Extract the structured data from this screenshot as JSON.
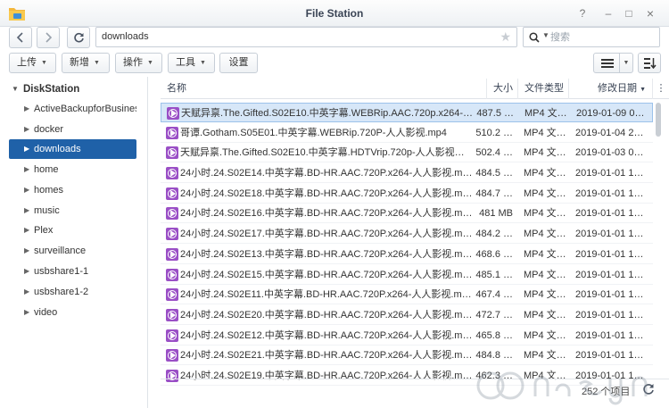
{
  "window": {
    "title": "File Station",
    "controls": [
      "?",
      "–",
      "□",
      "×"
    ]
  },
  "nav": {
    "back_icon": "chevron-left-icon",
    "forward_icon": "chevron-right-icon",
    "refresh_icon": "refresh-icon",
    "path": "downloads",
    "favorite_icon": "star-icon"
  },
  "search": {
    "placeholder": "搜索"
  },
  "toolbar": {
    "upload_label": "上传",
    "create_label": "新增",
    "action_label": "操作",
    "tools_label": "工具",
    "settings_label": "设置"
  },
  "sidebar": {
    "root": "DiskStation",
    "items": [
      {
        "label": "ActiveBackupforBusiness",
        "selected": false
      },
      {
        "label": "docker",
        "selected": false
      },
      {
        "label": "downloads",
        "selected": true
      },
      {
        "label": "home",
        "selected": false
      },
      {
        "label": "homes",
        "selected": false
      },
      {
        "label": "music",
        "selected": false
      },
      {
        "label": "Plex",
        "selected": false
      },
      {
        "label": "surveillance",
        "selected": false
      },
      {
        "label": "usbshare1-1",
        "selected": false
      },
      {
        "label": "usbshare1-2",
        "selected": false
      },
      {
        "label": "video",
        "selected": false
      }
    ]
  },
  "columns": {
    "name": "名称",
    "size": "大小",
    "type": "文件类型",
    "date": "修改日期"
  },
  "files": [
    {
      "name": "天赋异禀.The.Gifted.S02E10.中英字幕.WEBRip.AAC.720p.x264-…",
      "size": "487.5 …",
      "type": "MP4 文…",
      "date": "2019-01-09 0…",
      "selected": true
    },
    {
      "name": "哥谭.Gotham.S05E01.中英字幕.WEBRip.720P-人人影视.mp4",
      "size": "510.2 …",
      "type": "MP4 文…",
      "date": "2019-01-04 2…",
      "selected": false
    },
    {
      "name": "天赋异禀.The.Gifted.S02E10.中英字幕.HDTVrip.720p-人人影视…",
      "size": "502.4 …",
      "type": "MP4 文…",
      "date": "2019-01-03 0…",
      "selected": false
    },
    {
      "name": "24小时.24.S02E14.中英字幕.BD-HR.AAC.720P.x264-人人影视.m…",
      "size": "484.5 …",
      "type": "MP4 文…",
      "date": "2019-01-01 1…",
      "selected": false
    },
    {
      "name": "24小时.24.S02E18.中英字幕.BD-HR.AAC.720P.x264-人人影视.m…",
      "size": "484.7 …",
      "type": "MP4 文…",
      "date": "2019-01-01 1…",
      "selected": false
    },
    {
      "name": "24小时.24.S02E16.中英字幕.BD-HR.AAC.720P.x264-人人影视.m…",
      "size": "481 MB",
      "type": "MP4 文…",
      "date": "2019-01-01 1…",
      "selected": false
    },
    {
      "name": "24小时.24.S02E17.中英字幕.BD-HR.AAC.720P.x264-人人影视.m…",
      "size": "484.2 …",
      "type": "MP4 文…",
      "date": "2019-01-01 1…",
      "selected": false
    },
    {
      "name": "24小时.24.S02E13.中英字幕.BD-HR.AAC.720P.x264-人人影视.m…",
      "size": "468.6 …",
      "type": "MP4 文…",
      "date": "2019-01-01 1…",
      "selected": false
    },
    {
      "name": "24小时.24.S02E15.中英字幕.BD-HR.AAC.720P.x264-人人影视.m…",
      "size": "485.1 …",
      "type": "MP4 文…",
      "date": "2019-01-01 1…",
      "selected": false
    },
    {
      "name": "24小时.24.S02E11.中英字幕.BD-HR.AAC.720P.x264-人人影视.m…",
      "size": "467.4 …",
      "type": "MP4 文…",
      "date": "2019-01-01 1…",
      "selected": false
    },
    {
      "name": "24小时.24.S02E20.中英字幕.BD-HR.AAC.720P.x264-人人影视.m…",
      "size": "472.7 …",
      "type": "MP4 文…",
      "date": "2019-01-01 1…",
      "selected": false
    },
    {
      "name": "24小时.24.S02E12.中英字幕.BD-HR.AAC.720P.x264-人人影视.m…",
      "size": "465.8 …",
      "type": "MP4 文…",
      "date": "2019-01-01 1…",
      "selected": false
    },
    {
      "name": "24小时.24.S02E21.中英字幕.BD-HR.AAC.720P.x264-人人影视.m…",
      "size": "484.8 …",
      "type": "MP4 文…",
      "date": "2019-01-01 1…",
      "selected": false
    },
    {
      "name": "24小时.24.S02E19.中英字幕.BD-HR.AAC.720P.x264-人人影视.m…",
      "size": "462.3 …",
      "type": "MP4 文…",
      "date": "2019-01-01 1…",
      "selected": false
    }
  ],
  "status": {
    "count": "252 个项目"
  },
  "colors": {
    "selected_folder": "#1f61a8",
    "selected_row": "#d7e7f8",
    "file_icon": "#9a4fc6"
  }
}
